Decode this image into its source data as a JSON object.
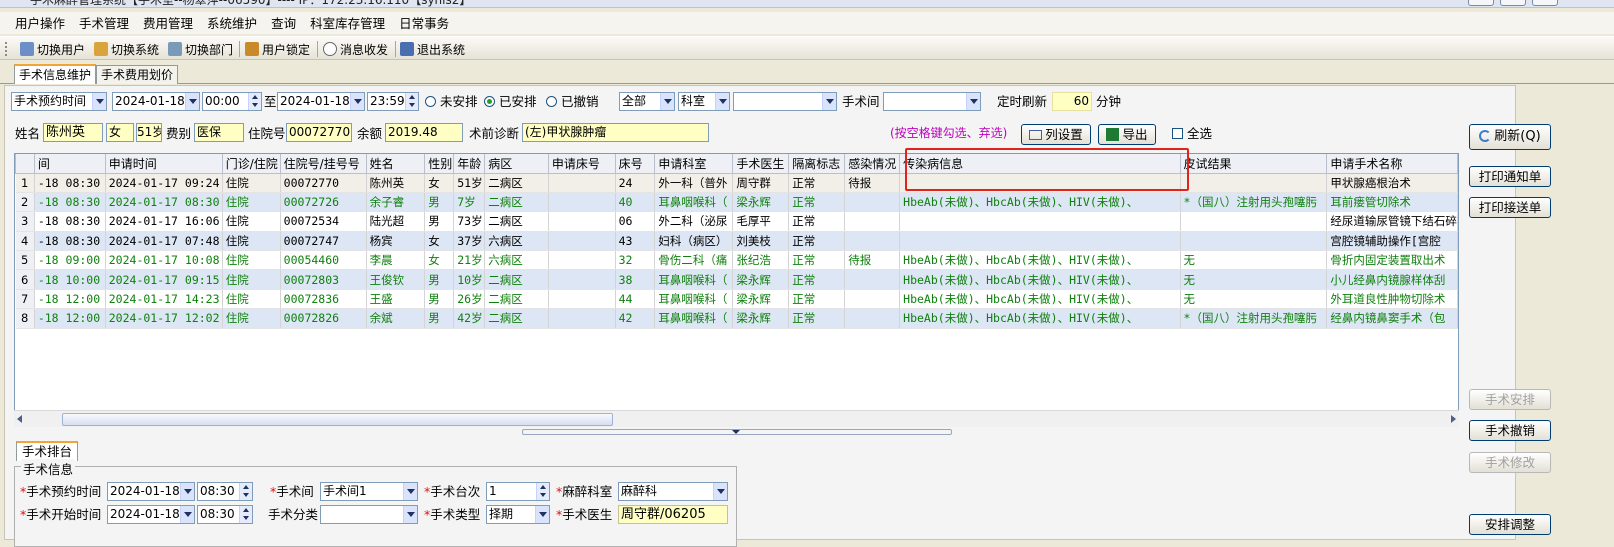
{
  "window": {
    "title": "手术麻醉管理系统【手术室--杨翠萍--06590】---- IP：172.23.16.110【synis2】"
  },
  "menu": [
    "用户操作",
    "手术管理",
    "费用管理",
    "系统维护",
    "查询",
    "科室库存管理",
    "日常事务"
  ],
  "toolbar": {
    "items": [
      "切换用户",
      "切换系统",
      "切换部门",
      "用户锁定",
      "消息收发",
      "退出系统"
    ]
  },
  "tabs": [
    "手术信息维护",
    "手术费用划价"
  ],
  "filters": {
    "type": "手术预约时间",
    "date_from": "2024-01-18",
    "time_from": "00:00",
    "to_label": "至",
    "date_to": "2024-01-18",
    "time_to": "23:59",
    "radio_unscheduled": "未安排",
    "radio_scheduled": "已安排",
    "radio_cancelled": "已撤销",
    "scope": "全部",
    "dept": "科室",
    "dept_value": "",
    "room_label": "手术间",
    "room_value": "",
    "refresh_label": "定时刷新",
    "refresh_value": "60",
    "refresh_unit": "分钟"
  },
  "patient": {
    "name_label": "姓名",
    "name": "陈州英",
    "sex": "女",
    "age": "51岁",
    "fee_label": "费别",
    "fee": "医保",
    "inpatient_label": "住院号",
    "inpatient_no": "00072770",
    "balance_label": "余额",
    "balance": "2019.48",
    "diag_label": "术前诊断",
    "diag": "(左)甲状腺肿瘤"
  },
  "hint": "(按空格键勾选、弃选)",
  "buttons": {
    "columns": "列设置",
    "export": "导出",
    "select_all": "全选",
    "refresh": "刷新(Q)",
    "print_notice": "打印通知单",
    "print_transfer": "打印接送单",
    "schedule": "手术安排",
    "cancel": "手术撤销",
    "modify": "手术修改",
    "adjust": "安排调整"
  },
  "grid": {
    "columns": [
      "间",
      "申请时间",
      "门诊/住院",
      "住院号/挂号号",
      "姓名",
      "性别",
      "年龄",
      "病区",
      "申请床号",
      "床号",
      "申请科室",
      "手术医生",
      "隔离标志",
      "感染情况",
      "传染病信息",
      "皮试结果",
      "申请手术名称"
    ],
    "rows": [
      [
        "1",
        "-18 08:30",
        "2024-01-17 09:24",
        "住院",
        "00072770",
        "陈州英",
        "女",
        "51岁",
        "二病区",
        "",
        "24",
        "外一科（普外",
        "周守群",
        "正常",
        "待报",
        "",
        "",
        "甲状腺癌根治术"
      ],
      [
        "2",
        "-18 08:30",
        "2024-01-17 08:30",
        "住院",
        "00072726",
        "余子睿",
        "男",
        "7岁",
        "二病区",
        "",
        "40",
        "耳鼻咽喉科（",
        "梁永辉",
        "正常",
        "",
        "HbeAb(未做)、HbcAb(未做)、HIV(未做)、",
        "*（国八）注射用头孢噻肟",
        "耳前瘘管切除术"
      ],
      [
        "3",
        "-18 08:30",
        "2024-01-17 16:06",
        "住院",
        "00072534",
        "陆光超",
        "男",
        "73岁",
        "二病区",
        "",
        "06",
        "外二科（泌尿",
        "毛厚平",
        "正常",
        "",
        "",
        "",
        "经尿道输尿管镜下结石碎"
      ],
      [
        "4",
        "-18 08:30",
        "2024-01-17 07:48",
        "住院",
        "00072747",
        "杨宾",
        "女",
        "37岁",
        "六病区",
        "",
        "43",
        "妇科（病区）",
        "刘美枝",
        "正常",
        "",
        "",
        "",
        "宫腔镜辅助操作[宫腔"
      ],
      [
        "5",
        "-18 09:00",
        "2024-01-17 10:08",
        "住院",
        "00054460",
        "李晨",
        "女",
        "21岁",
        "六病区",
        "",
        "32",
        "骨伤二科（痛",
        "张纪浩",
        "正常",
        "待报",
        "HbeAb(未做)、HbcAb(未做)、HIV(未做)、",
        "无",
        "骨折内固定装置取出术"
      ],
      [
        "6",
        "-18 10:00",
        "2024-01-17 09:15",
        "住院",
        "00072803",
        "王俊钦",
        "男",
        "10岁",
        "二病区",
        "",
        "38",
        "耳鼻咽喉科（",
        "梁永辉",
        "正常",
        "",
        "HbeAb(未做)、HbcAb(未做)、HIV(未做)、",
        "无",
        "小儿经鼻内镜腺样体刮"
      ],
      [
        "7",
        "-18 12:00",
        "2024-01-17 14:23",
        "住院",
        "00072836",
        "王盛",
        "男",
        "26岁",
        "二病区",
        "",
        "44",
        "耳鼻咽喉科（",
        "梁永辉",
        "正常",
        "",
        "HbeAb(未做)、HbcAb(未做)、HIV(未做)、",
        "无",
        "外耳道良性肿物切除术"
      ],
      [
        "8",
        "-18 12:00",
        "2024-01-17 12:02",
        "住院",
        "00072826",
        "余斌",
        "男",
        "42岁",
        "二病区",
        "",
        "42",
        "耳鼻咽喉科（",
        "梁永辉",
        "正常",
        "",
        "HbeAb(未做)、HbcAb(未做)、HIV(未做)、",
        "*（国八）注射用头孢噻肟",
        "经鼻内镜鼻窦手术（包"
      ]
    ]
  },
  "bottom": {
    "tab": "手术排台",
    "group": "手术信息",
    "appt_label": "手术预约时间",
    "appt_date": "2024-01-18",
    "appt_time": "08:30",
    "room_label": "手术间",
    "room_value": "手术间1",
    "seq_label": "手术台次",
    "seq_value": "1",
    "anes_dept_label": "麻醉科室",
    "anes_dept_value": "麻醉科",
    "start_label": "手术开始时间",
    "start_date": "2024-01-18",
    "start_time": "08:30",
    "cat_label": "手术分类",
    "cat_value": "",
    "type_label": "手术类型",
    "type_value": "择期",
    "doctor_label": "手术医生",
    "doctor_value": "周守群/06205"
  },
  "colors": {
    "accent_red": "#e0241d",
    "green_text": "#10800e",
    "hint_magenta": "#c000c0",
    "field_yellow": "#ffffc4"
  }
}
